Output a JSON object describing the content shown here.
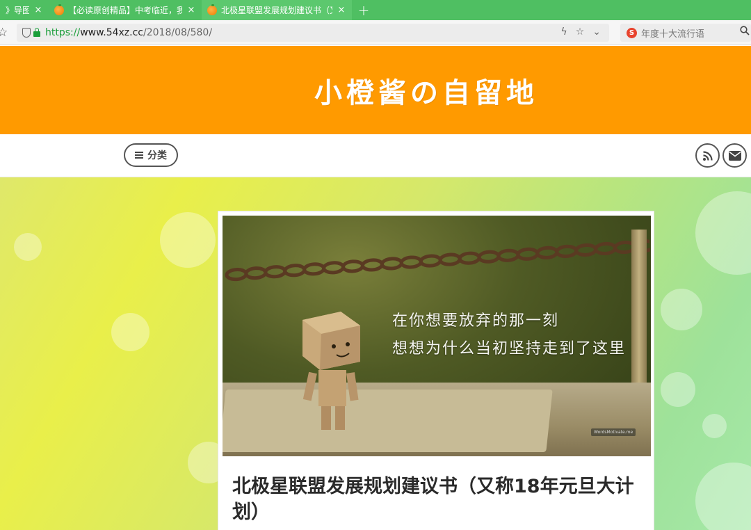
{
  "browser": {
    "tabs": [
      {
        "title": "》导图",
        "active": false
      },
      {
        "title": "【必读原创精品】中考临近，我",
        "active": false
      },
      {
        "title": "北极星联盟发展规划建议书（又",
        "active": true
      }
    ],
    "tab_close_glyph": "×",
    "new_tab_glyph": "+",
    "url_scheme": "https://",
    "url_host": "www.54xz.cc",
    "url_path": "/2018/08/580/",
    "search_placeholder": "年度十大流行语",
    "search_engine_badge": "S"
  },
  "site": {
    "title": "小橙酱の自留地",
    "header_color": "#ff9a00"
  },
  "nav": {
    "category_label": "分类",
    "icons": [
      "rss-icon",
      "mail-icon"
    ]
  },
  "post": {
    "image_quote_line1": "在你想要放弃的那一刻",
    "image_quote_line2": "想想为什么当初坚持走到了这里",
    "watermark": "WordsMotivate.me",
    "title": "北极星联盟发展规划建议书（又称18年元旦大计划）"
  }
}
